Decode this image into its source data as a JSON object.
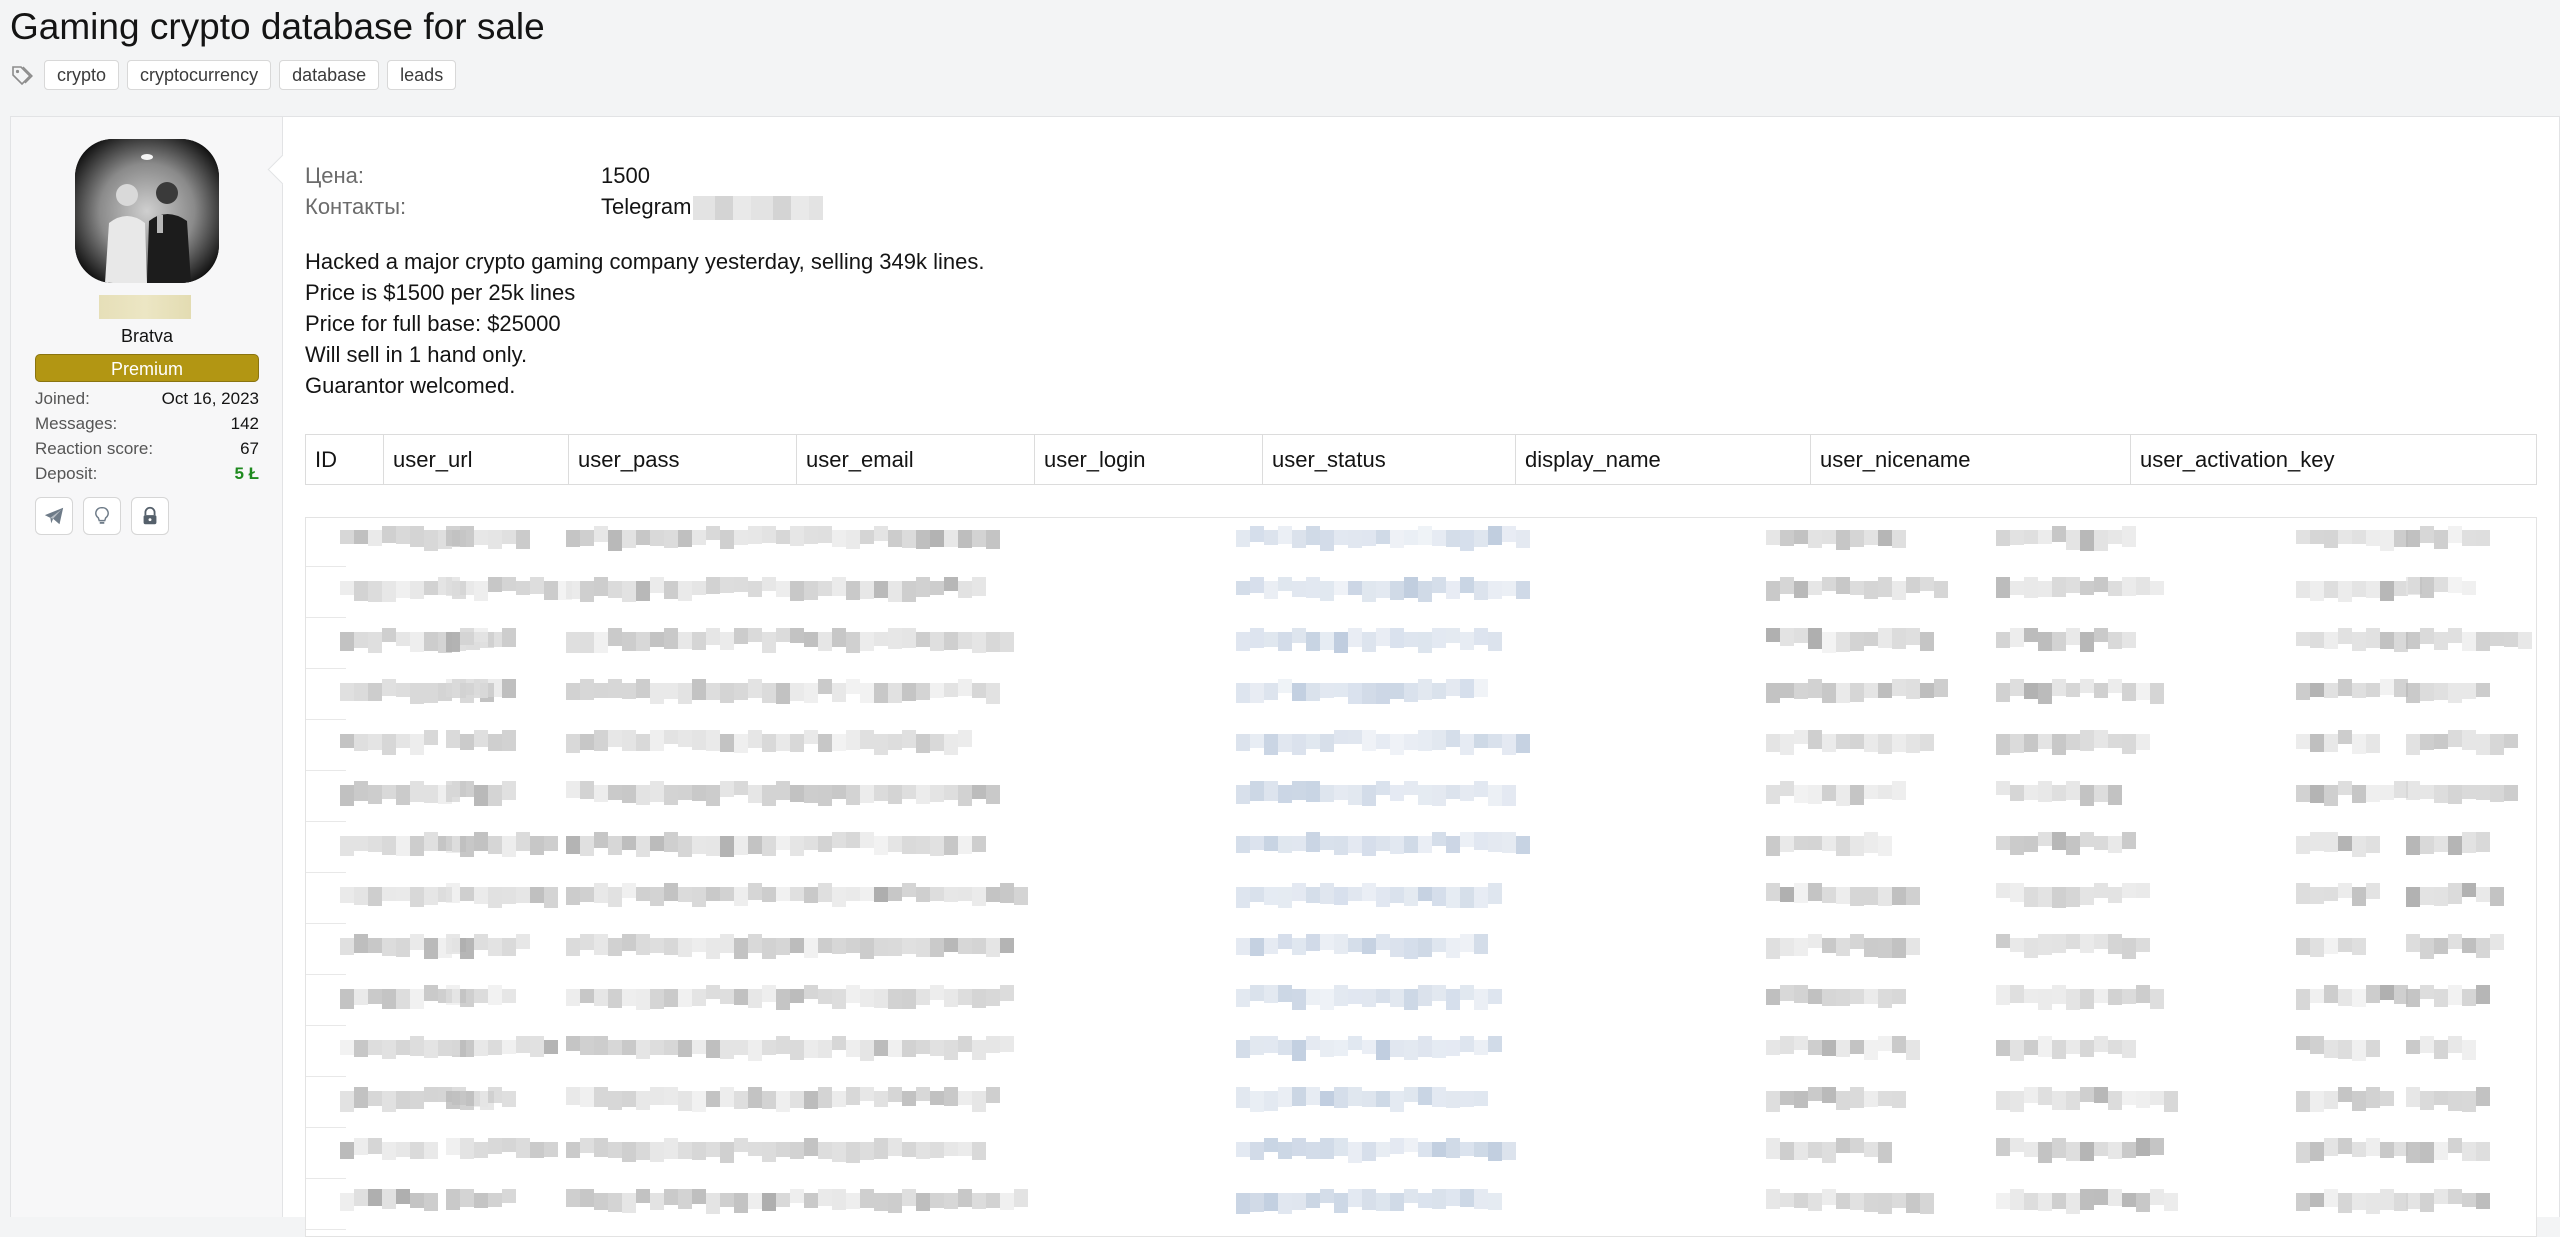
{
  "thread": {
    "title": "Gaming crypto database for sale",
    "tags": [
      "crypto",
      "cryptocurrency",
      "database",
      "leads"
    ]
  },
  "user": {
    "user_title": "Bratva",
    "banner": "Premium",
    "stats": [
      {
        "label": "Joined:",
        "value": "Oct 16, 2023"
      },
      {
        "label": "Messages:",
        "value": "142"
      },
      {
        "label": "Reaction score:",
        "value": "67"
      },
      {
        "label": "Deposit:",
        "value": "5 Ł"
      }
    ],
    "icons": [
      "telegram-icon",
      "lightbulb-icon",
      "lock-icon"
    ]
  },
  "post": {
    "fields": [
      {
        "label": "Цена:",
        "value": "1500"
      },
      {
        "label": "Контакты:",
        "value": "Telegram"
      }
    ],
    "lines": [
      "Hacked a major crypto gaming company yesterday, selling 349k lines.",
      "Price is $1500 per 25k lines",
      "Price for full base: $25000",
      "Will sell in 1 hand only.",
      "Guarantor welcomed."
    ],
    "table_headers": [
      "ID",
      "user_url",
      "user_pass",
      "user_email",
      "user_login",
      "user_status",
      "display_name",
      "user_nicename",
      "user_activation_key"
    ]
  },
  "colors": {
    "banner": "#b29613",
    "deposit": "#1f8a1f",
    "blur_gray": "#c9c9c9",
    "blur_blue": "#c3d0e0"
  }
}
